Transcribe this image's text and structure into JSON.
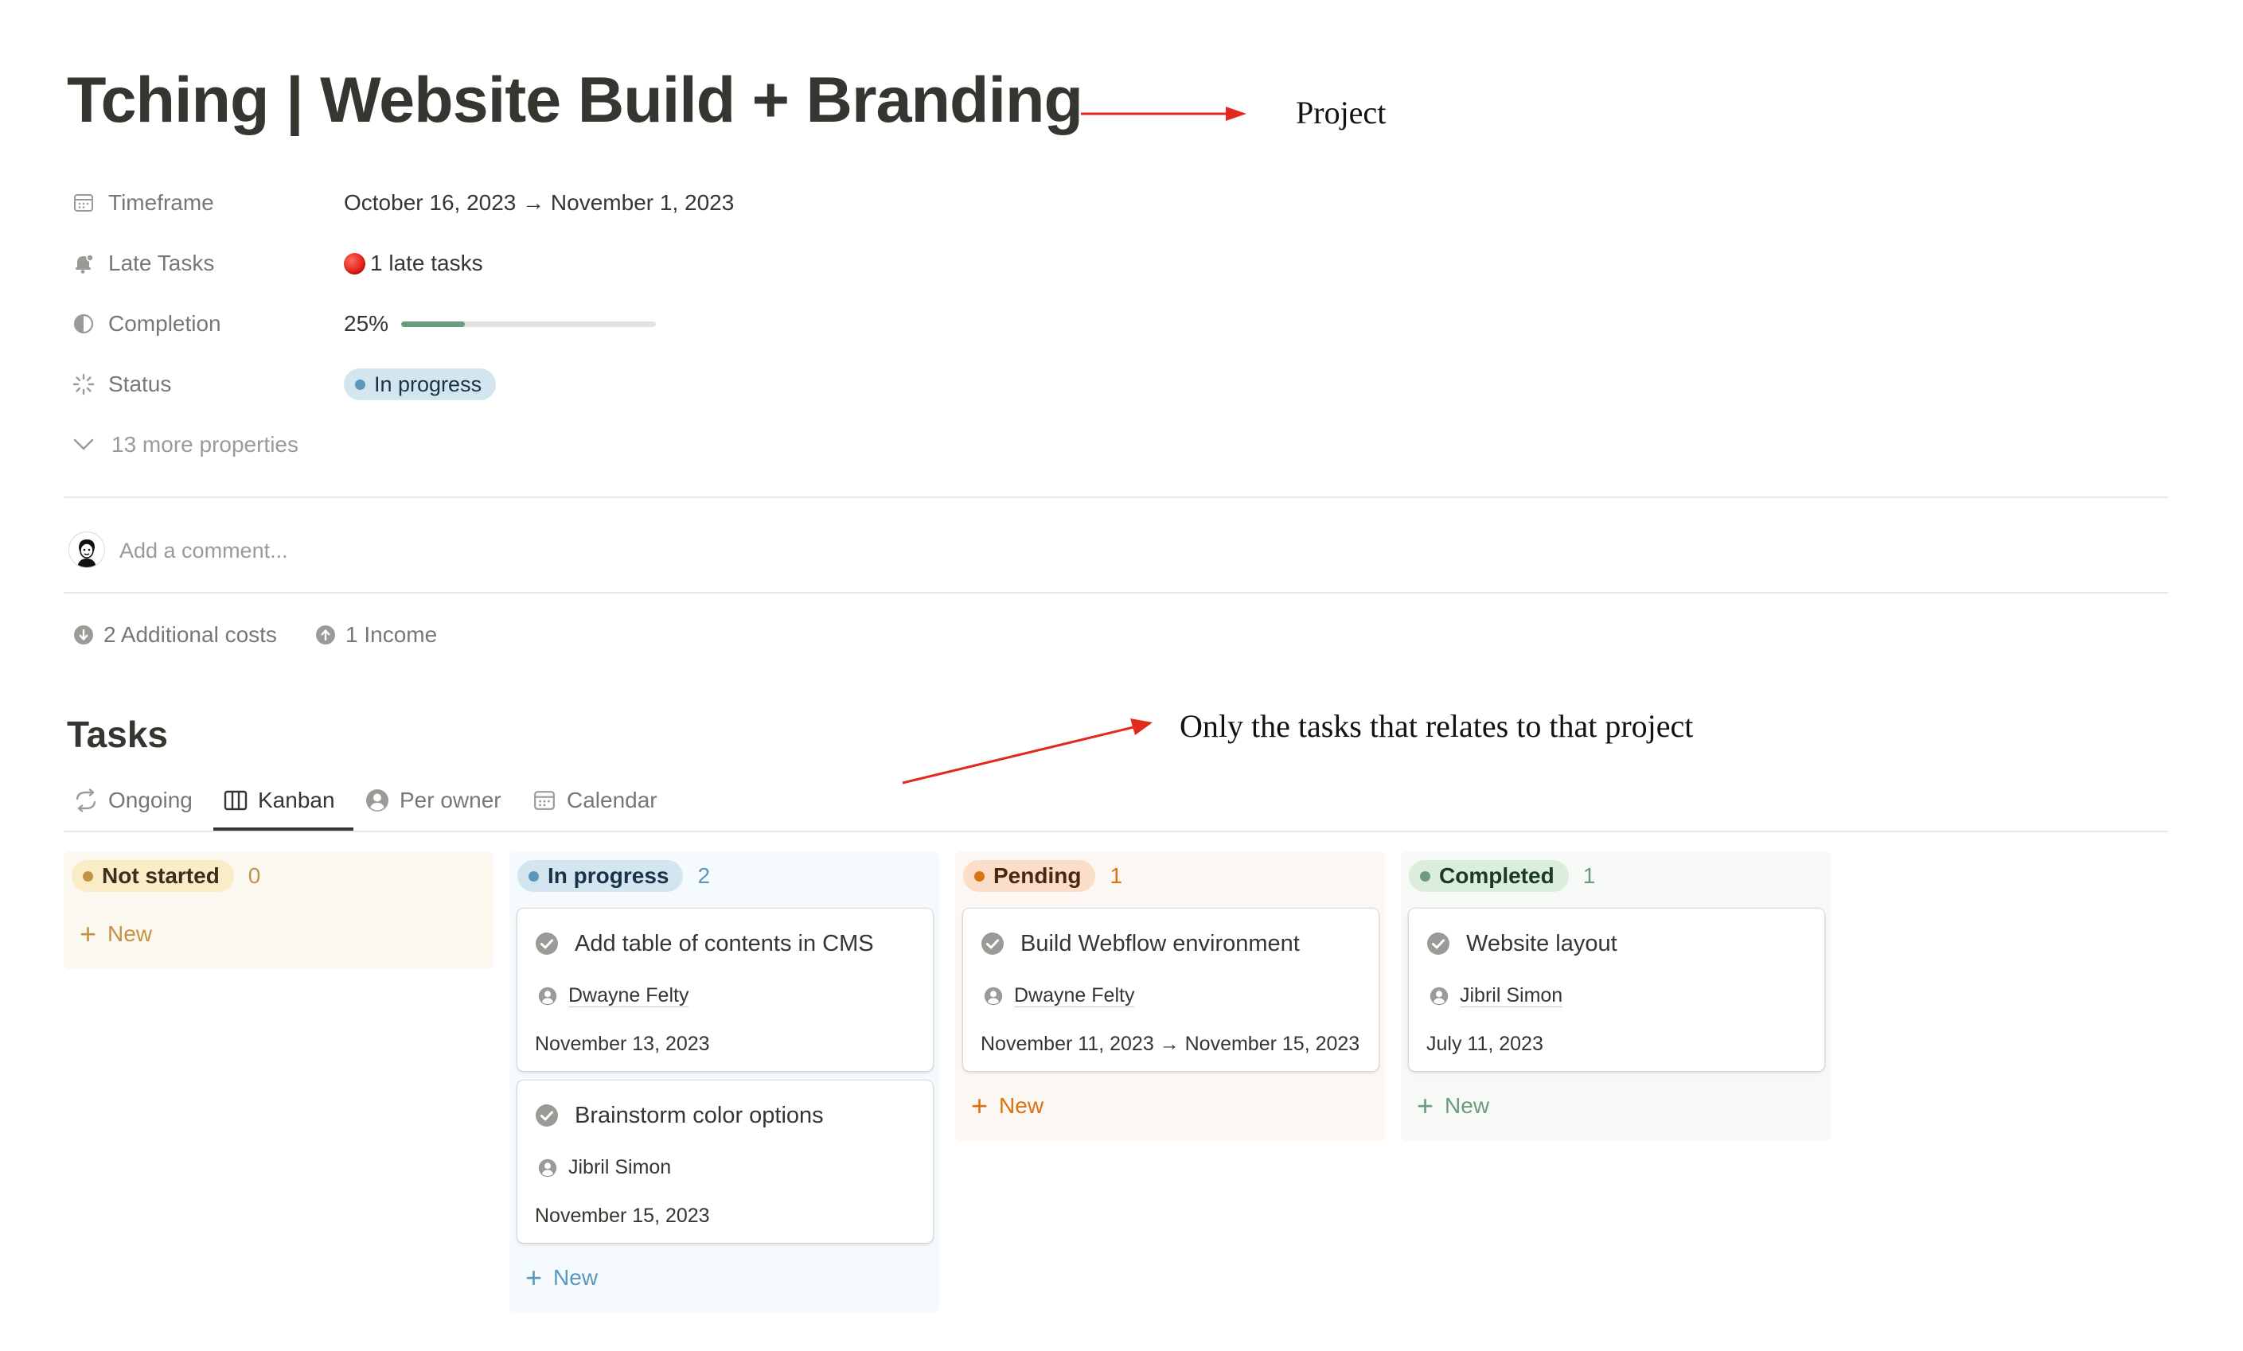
{
  "page": {
    "title": "Tching | Website Build + Branding"
  },
  "annotations": {
    "project": "Project",
    "tasks_note": "Only the tasks that relates to that project"
  },
  "properties": {
    "timeframe": {
      "label": "Timeframe",
      "value": "October 16, 2023 → November 1, 2023",
      "icon": "calendar-icon"
    },
    "late_tasks": {
      "label": "Late Tasks",
      "value": "1 late tasks",
      "icon": "bell-icon",
      "indicator": "red-circle"
    },
    "completion": {
      "label": "Completion",
      "value": "25%",
      "progress": 0.25,
      "icon": "pie-chart-icon"
    },
    "status": {
      "label": "Status",
      "value": "In progress",
      "icon": "spinner-icon"
    },
    "more": {
      "label": "13 more properties"
    }
  },
  "comment": {
    "placeholder": "Add a comment..."
  },
  "relations": {
    "costs": "2 Additional costs",
    "income": "1 Income"
  },
  "tasks": {
    "title": "Tasks",
    "tabs": [
      {
        "label": "Ongoing",
        "icon": "refresh-icon"
      },
      {
        "label": "Kanban",
        "icon": "board-icon",
        "active": true
      },
      {
        "label": "Per owner",
        "icon": "person-icon"
      },
      {
        "label": "Calendar",
        "icon": "calendar-icon"
      }
    ],
    "columns": [
      {
        "label": "Not started",
        "count": "0",
        "new_label": "New",
        "cards": []
      },
      {
        "label": "In progress",
        "count": "2",
        "new_label": "New",
        "cards": [
          {
            "title": "Add table of contents in CMS",
            "owner": "Dwayne Felty",
            "date": "November 13, 2023"
          },
          {
            "title": "Brainstorm color options",
            "owner": "Jibril Simon",
            "date": "November 15, 2023"
          }
        ]
      },
      {
        "label": "Pending",
        "count": "1",
        "new_label": "New",
        "cards": [
          {
            "title": "Build Webflow environment",
            "owner": "Dwayne Felty",
            "date": "November 11, 2023 → November 15, 2023"
          }
        ]
      },
      {
        "label": "Completed",
        "count": "1",
        "new_label": "New",
        "cards": [
          {
            "title": "Website layout",
            "owner": "Jibril Simon",
            "date": "July 11, 2023"
          }
        ]
      }
    ]
  },
  "colors": {
    "not_started_bg": "#fbf8ef",
    "not_started_pill": "#fbecc8",
    "not_started_text": "#402c1b",
    "not_started_accent": "#c29343",
    "in_progress_bg": "#f5fafc",
    "in_progress_pill": "#d3e5ef",
    "in_progress_text": "#183347",
    "in_progress_accent": "#5b97bd",
    "pending_bg": "#fdf7f3",
    "pending_pill": "#fadec9",
    "pending_text": "#49290e",
    "pending_accent": "#d9730d",
    "completed_bg": "#f6f9f6",
    "completed_pill": "#dbeddb",
    "completed_text": "#1c3829",
    "completed_accent": "#6c9b7d"
  }
}
